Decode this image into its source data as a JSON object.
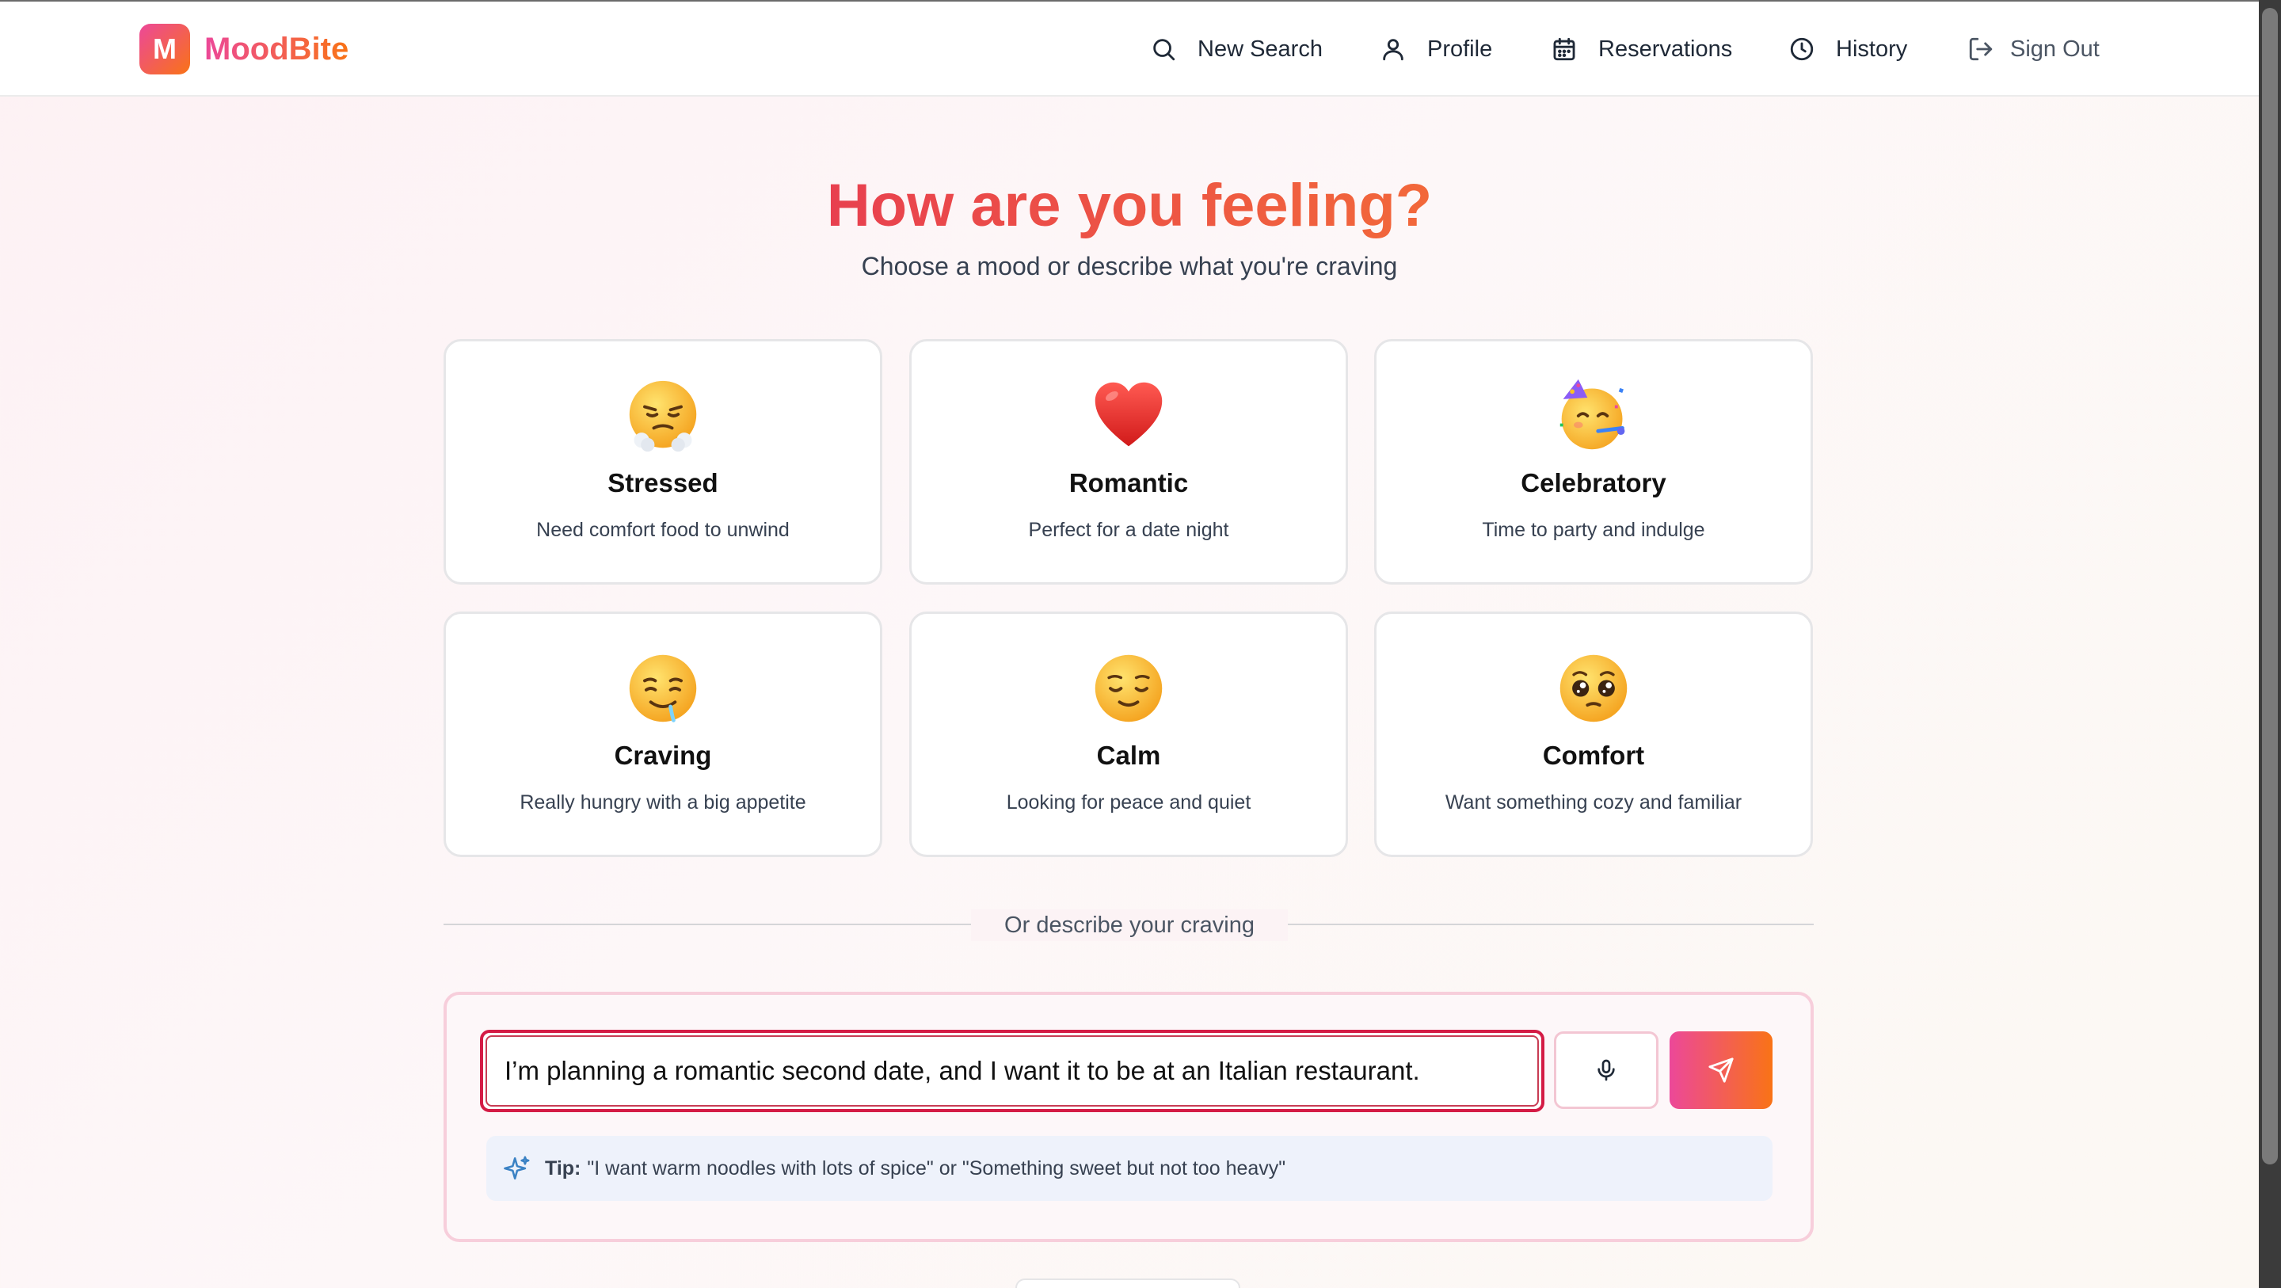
{
  "app": {
    "logo_letter": "M",
    "name": "MoodBite"
  },
  "nav": [
    {
      "label": "New Search",
      "icon": "search-icon"
    },
    {
      "label": "Profile",
      "icon": "user-icon"
    },
    {
      "label": "Reservations",
      "icon": "calendar-icon"
    },
    {
      "label": "History",
      "icon": "clock-icon"
    },
    {
      "label": "Sign Out",
      "icon": "sign-out-icon"
    }
  ],
  "hero": {
    "title": "How are you feeling?",
    "subtitle": "Choose a mood or describe what you're craving"
  },
  "moods": [
    {
      "name": "Stressed",
      "desc": "Need comfort food to unwind",
      "icon": "steaming-face-icon"
    },
    {
      "name": "Romantic",
      "desc": "Perfect for a date night",
      "icon": "red-heart-icon"
    },
    {
      "name": "Celebratory",
      "desc": "Time to party and indulge",
      "icon": "party-face-icon"
    },
    {
      "name": "Craving",
      "desc": "Really hungry with a big appetite",
      "icon": "drooling-face-icon"
    },
    {
      "name": "Calm",
      "desc": "Looking for peace and quiet",
      "icon": "relieved-face-icon"
    },
    {
      "name": "Comfort",
      "desc": "Want something cozy and familiar",
      "icon": "pleading-face-icon"
    }
  ],
  "divider": {
    "label": "Or describe your craving"
  },
  "craving": {
    "value": "I’m planning a romantic second date, and I want it to be at an Italian restaurant.",
    "placeholder": ""
  },
  "tip": {
    "label": "Tip:",
    "text": "\"I want warm noodles with lots of spice\" or \"Something sweet but not too heavy\""
  },
  "colors": {
    "brand_pink": "#ec4899",
    "brand_orange": "#f97316",
    "title_red": "#e8404f",
    "input_focus": "#d41b45"
  }
}
